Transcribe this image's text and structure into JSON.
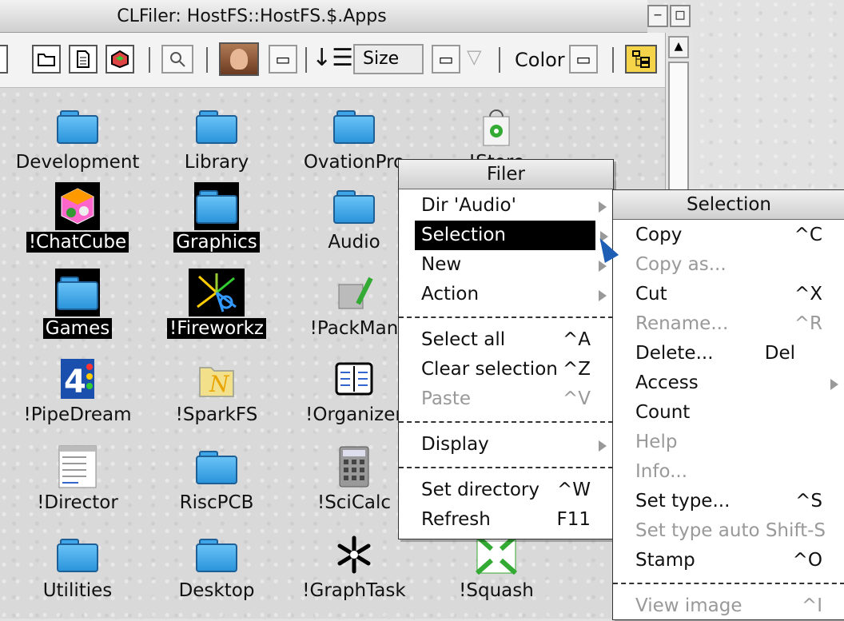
{
  "window": {
    "title": "CLFiler: HostFS::HostFS.$.Apps"
  },
  "toolbar": {
    "sort_field": "Size",
    "color_label": "Color"
  },
  "icons": [
    {
      "label": "Development",
      "selected": false,
      "icon": "folder-icon"
    },
    {
      "label": "Library",
      "selected": false,
      "icon": "folder-icon"
    },
    {
      "label": "OvationPro",
      "selected": false,
      "icon": "folder-icon"
    },
    {
      "label": "!Store",
      "selected": false,
      "icon": "store-bag-icon"
    },
    {
      "label": "!ChatCube",
      "selected": true,
      "icon": "chatcube-icon"
    },
    {
      "label": "Graphics",
      "selected": true,
      "icon": "folder-icon"
    },
    {
      "label": "Audio",
      "selected": false,
      "icon": "folder-icon"
    },
    {
      "label": "Games",
      "selected": true,
      "icon": "folder-icon"
    },
    {
      "label": "!Fireworkz",
      "selected": true,
      "icon": "fireworkz-icon"
    },
    {
      "label": "!PackMan",
      "selected": false,
      "icon": "packman-icon"
    },
    {
      "label": "!PipeDream",
      "selected": false,
      "icon": "pipedream-icon"
    },
    {
      "label": "!SparkFS",
      "selected": false,
      "icon": "sparkfs-icon"
    },
    {
      "label": "!Organizer",
      "selected": false,
      "icon": "organizer-icon"
    },
    {
      "label": "!Director",
      "selected": false,
      "icon": "director-icon"
    },
    {
      "label": "RiscPCB",
      "selected": false,
      "icon": "folder-icon"
    },
    {
      "label": "!SciCalc",
      "selected": false,
      "icon": "calculator-icon"
    },
    {
      "label": "Utilities",
      "selected": false,
      "icon": "folder-icon"
    },
    {
      "label": "Desktop",
      "selected": false,
      "icon": "folder-icon"
    },
    {
      "label": "!GraphTask",
      "selected": false,
      "icon": "asterisk-icon"
    },
    {
      "label": "!Squash",
      "selected": false,
      "icon": "squash-icon"
    }
  ],
  "filer_menu": {
    "title": "Filer",
    "items": [
      {
        "label": "Dir 'Audio'",
        "shortcut": "",
        "submenu": true,
        "disabled": false,
        "highlight": false
      },
      {
        "label": "Selection",
        "shortcut": "",
        "submenu": true,
        "disabled": false,
        "highlight": true
      },
      {
        "label": "New",
        "shortcut": "",
        "submenu": true,
        "disabled": false,
        "highlight": false
      },
      {
        "label": "Action",
        "shortcut": "",
        "submenu": true,
        "disabled": false,
        "highlight": false
      },
      {
        "label": "Select all",
        "shortcut": "^A",
        "submenu": false,
        "disabled": false,
        "highlight": false
      },
      {
        "label": "Clear selection",
        "shortcut": "^Z",
        "submenu": false,
        "disabled": false,
        "highlight": false
      },
      {
        "label": "Paste",
        "shortcut": "^V",
        "submenu": false,
        "disabled": true,
        "highlight": false
      },
      {
        "label": "Display",
        "shortcut": "",
        "submenu": true,
        "disabled": false,
        "highlight": false
      },
      {
        "label": "Set directory",
        "shortcut": "^W",
        "submenu": false,
        "disabled": false,
        "highlight": false
      },
      {
        "label": "Refresh",
        "shortcut": "F11",
        "submenu": false,
        "disabled": false,
        "highlight": false
      }
    ]
  },
  "selection_menu": {
    "title": "Selection",
    "items": [
      {
        "label": "Copy",
        "shortcut": "^C",
        "disabled": false,
        "submenu": false
      },
      {
        "label": "Copy as...",
        "shortcut": "",
        "disabled": true,
        "submenu": false
      },
      {
        "label": "Cut",
        "shortcut": "^X",
        "disabled": false,
        "submenu": false
      },
      {
        "label": "Rename...",
        "shortcut": "^R",
        "disabled": true,
        "submenu": false
      },
      {
        "label": "Delete...",
        "shortcut": "Del",
        "disabled": false,
        "submenu": false
      },
      {
        "label": "Access",
        "shortcut": "",
        "disabled": false,
        "submenu": true
      },
      {
        "label": "Count",
        "shortcut": "",
        "disabled": false,
        "submenu": false
      },
      {
        "label": "Help",
        "shortcut": "",
        "disabled": true,
        "submenu": false
      },
      {
        "label": "Info...",
        "shortcut": "",
        "disabled": true,
        "submenu": false
      },
      {
        "label": "Set type...",
        "shortcut": "^S",
        "disabled": false,
        "submenu": false
      },
      {
        "label": "Set type auto",
        "shortcut": "Shift-S",
        "disabled": true,
        "submenu": false
      },
      {
        "label": "Stamp",
        "shortcut": "^O",
        "disabled": false,
        "submenu": false
      },
      {
        "label": "View image",
        "shortcut": "^I",
        "disabled": true,
        "submenu": false
      }
    ]
  }
}
